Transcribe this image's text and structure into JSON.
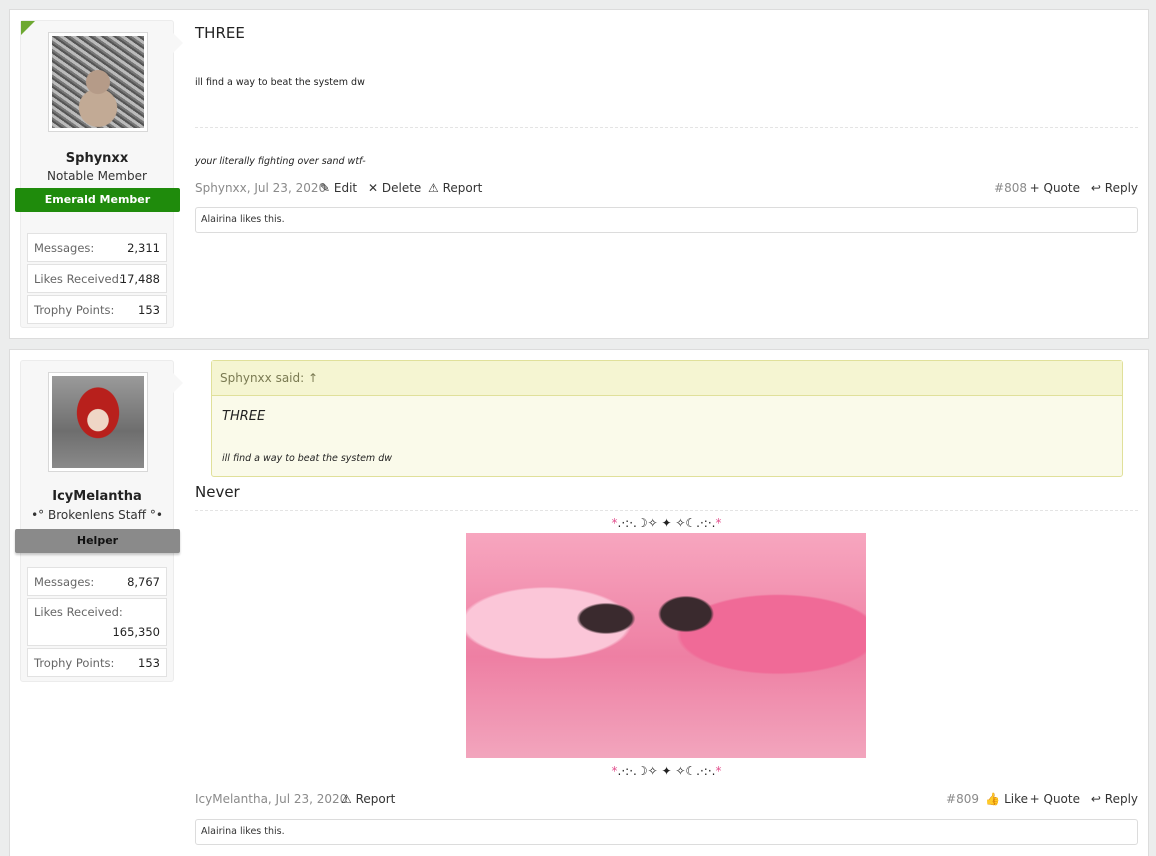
{
  "posts": [
    {
      "user": {
        "name": "Sphynxx",
        "title": "Notable Member",
        "banner": "Emerald Member",
        "banner_color": "#1f8b0c",
        "avatar_icon": "sphynx-cat-avatar",
        "stats": [
          {
            "label": "Messages:",
            "value": "2,311"
          },
          {
            "label": "Likes Received:",
            "value": "17,488"
          },
          {
            "label": "Trophy Points:",
            "value": "153"
          }
        ]
      },
      "headline": "THREE",
      "line1": "ill find a way to beat the system dw",
      "line2": "your literally fighting over sand wtf-",
      "meta": {
        "author_date": "Sphynxx, Jul 23, 2020",
        "edit": "Edit",
        "delete": "Delete",
        "report": "Report",
        "number": "#808",
        "quote": "+ Quote",
        "reply": "Reply"
      },
      "likes": "Alairina likes this."
    },
    {
      "user": {
        "name": "IcyMelantha",
        "title": "•° Brokenlens Staff °•",
        "banner": "Helper",
        "banner_color": "#8a8a8a",
        "avatar_icon": "red-hair-anime-avatar",
        "stats": [
          {
            "label": "Messages:",
            "value": "8,767"
          },
          {
            "label": "Likes Received:",
            "value": "165,350"
          },
          {
            "label": "Trophy Points:",
            "value": "153"
          }
        ]
      },
      "quote": {
        "header": "Sphynxx said: ↑",
        "title": "THREE",
        "text": "ill find a way to beat the system dw"
      },
      "headline": "Never",
      "deco_star": "*",
      "deco_mid": ".·:·.☽✧ ✦ ✧☾.·:·.",
      "meta": {
        "author_date": "IcyMelantha, Jul 23, 2020",
        "report": "Report",
        "number": "#809",
        "like": "Like",
        "quote": "+ Quote",
        "reply": "Reply"
      },
      "likes": "Alairina likes this."
    }
  ]
}
